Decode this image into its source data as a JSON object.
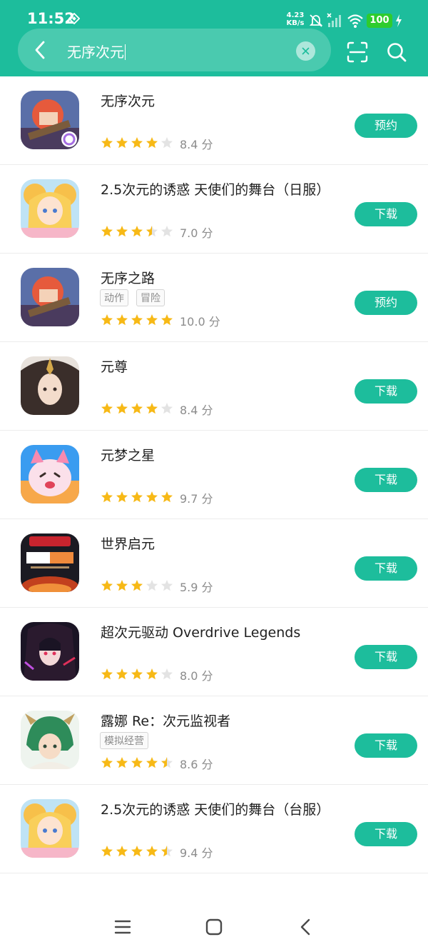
{
  "status": {
    "time": "11:52",
    "net_speed_value": "4.23",
    "net_speed_unit": "KB/s",
    "battery": "100",
    "icons": [
      "notification-icon",
      "mute-icon",
      "no-signal-icon",
      "wifi-icon",
      "battery-icon",
      "charging-icon"
    ]
  },
  "search": {
    "query": "无序次元"
  },
  "colors": {
    "accent": "#1dbd9c",
    "star": "#f7b916",
    "star_empty": "#e3e3e3"
  },
  "apps": [
    {
      "name": "无序次元",
      "tags": [],
      "rating": "8.4 分",
      "stars": 4,
      "action": "预约"
    },
    {
      "name": "2.5次元的诱惑 天使们的舞台（日服）",
      "tags": [],
      "rating": "7.0 分",
      "stars": 3.5,
      "action": "下载"
    },
    {
      "name": "无序之路",
      "tags": [
        "动作",
        "冒险"
      ],
      "rating": "10.0 分",
      "stars": 5,
      "action": "预约"
    },
    {
      "name": "元尊",
      "tags": [],
      "rating": "8.4 分",
      "stars": 4,
      "action": "下载"
    },
    {
      "name": "元梦之星",
      "tags": [],
      "rating": "9.7 分",
      "stars": 5,
      "action": "下载"
    },
    {
      "name": "世界启元",
      "tags": [],
      "rating": "5.9 分",
      "stars": 3,
      "action": "下载"
    },
    {
      "name": "超次元驱动 Overdrive Legends",
      "tags": [],
      "rating": "8.0 分",
      "stars": 4,
      "action": "下载"
    },
    {
      "name": "露娜 Re：次元监视者",
      "tags": [
        "模拟经营"
      ],
      "rating": "8.6 分",
      "stars": 4.5,
      "action": "下载"
    },
    {
      "name": "2.5次元的诱惑 天使们的舞台（台服）",
      "tags": [],
      "rating": "9.4 分",
      "stars": 4.5,
      "action": "下载"
    }
  ],
  "navbar": {
    "icons": [
      "menu-icon",
      "home-icon",
      "back-icon"
    ]
  }
}
